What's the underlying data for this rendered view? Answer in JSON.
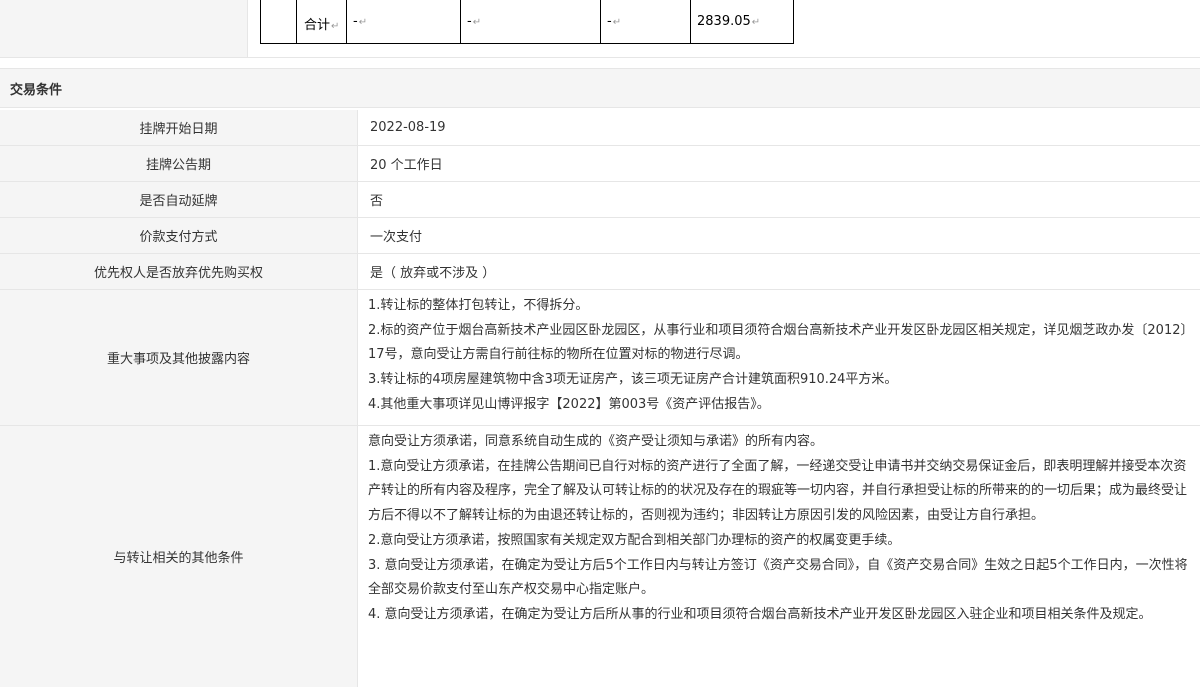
{
  "inner_table": {
    "total_label": "合计",
    "col2": "-",
    "col3": "-",
    "col4": "-",
    "total_value": "2839.05",
    "para_mark": "↵"
  },
  "section": {
    "title": "交易条件"
  },
  "rows": [
    {
      "label": "挂牌开始日期",
      "value": "2022-08-19"
    },
    {
      "label": "挂牌公告期",
      "value": "20 个工作日"
    },
    {
      "label": "是否自动延牌",
      "value": "否"
    },
    {
      "label": "价款支付方式",
      "value": "一次支付"
    },
    {
      "label": "优先权人是否放弃优先购买权",
      "value": "是（ 放弃或不涉及 ）"
    }
  ],
  "major_matters": {
    "label": "重大事项及其他披露内容",
    "lines": [
      "1.转让标的整体打包转让，不得拆分。",
      "2.标的资产位于烟台高新技术产业园区卧龙园区，从事行业和项目须符合烟台高新技术产业开发区卧龙园区相关规定，详见烟芝政办发〔2012〕17号，意向受让方需自行前往标的物所在位置对标的物进行尽调。",
      "3.转让标的4项房屋建筑物中含3项无证房产，该三项无证房产合计建筑面积910.24平方米。",
      "4.其他重大事项详见山博评报字【2022】第003号《资产评估报告》。"
    ]
  },
  "other_conditions": {
    "label": "与转让相关的其他条件",
    "lines": [
      "意向受让方须承诺，同意系统自动生成的《资产受让须知与承诺》的所有内容。",
      "1.意向受让方须承诺，在挂牌公告期间已自行对标的资产进行了全面了解，一经递交受让申请书并交纳交易保证金后，即表明理解并接受本次资产转让的所有内容及程序，完全了解及认可转让标的的状况及存在的瑕疵等一切内容，并自行承担受让标的所带来的的一切后果；成为最终受让方后不得以不了解转让标的为由退还转让标的，否则视为违约；非因转让方原因引发的风险因素，由受让方自行承担。",
      "2.意向受让方须承诺，按照国家有关规定双方配合到相关部门办理标的资产的权属变更手续。",
      "3. 意向受让方须承诺，在确定为受让方后5个工作日内与转让方签订《资产交易合同》，自《资产交易合同》生效之日起5个工作日内，一次性将全部交易价款支付至山东产权交易中心指定账户。",
      "4. 意向受让方须承诺，在确定为受让方后所从事的行业和项目须符合烟台高新技术产业开发区卧龙园区入驻企业和项目相关条件及规定。"
    ]
  }
}
